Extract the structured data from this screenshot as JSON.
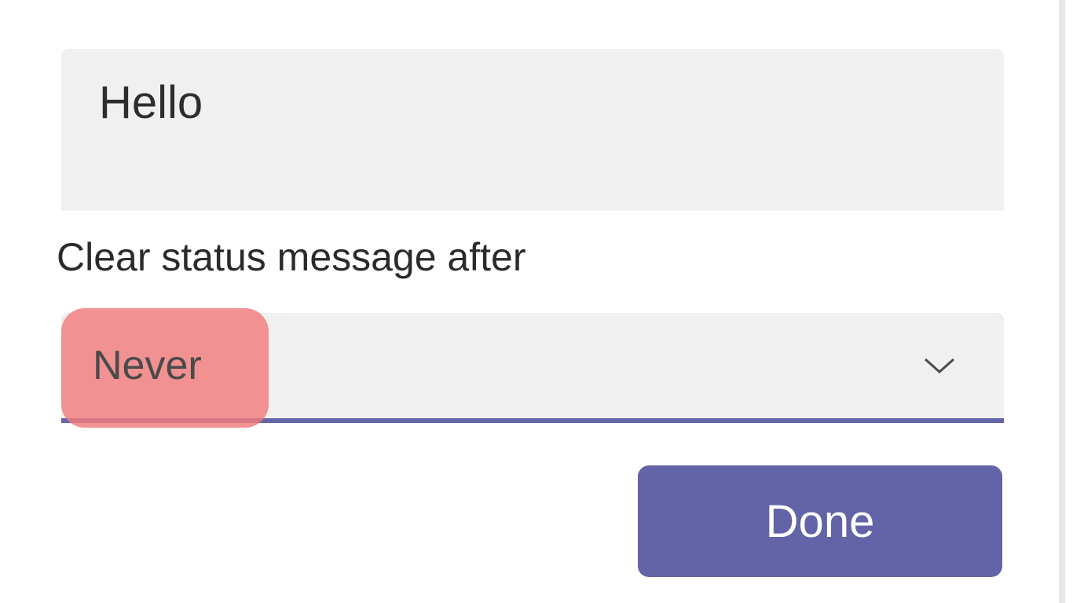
{
  "status": {
    "message": "Hello"
  },
  "clearAfter": {
    "label": "Clear status message after",
    "value": "Never"
  },
  "actions": {
    "done": "Done"
  },
  "colors": {
    "accent": "#6264a7",
    "highlight": "#f07b7b"
  }
}
